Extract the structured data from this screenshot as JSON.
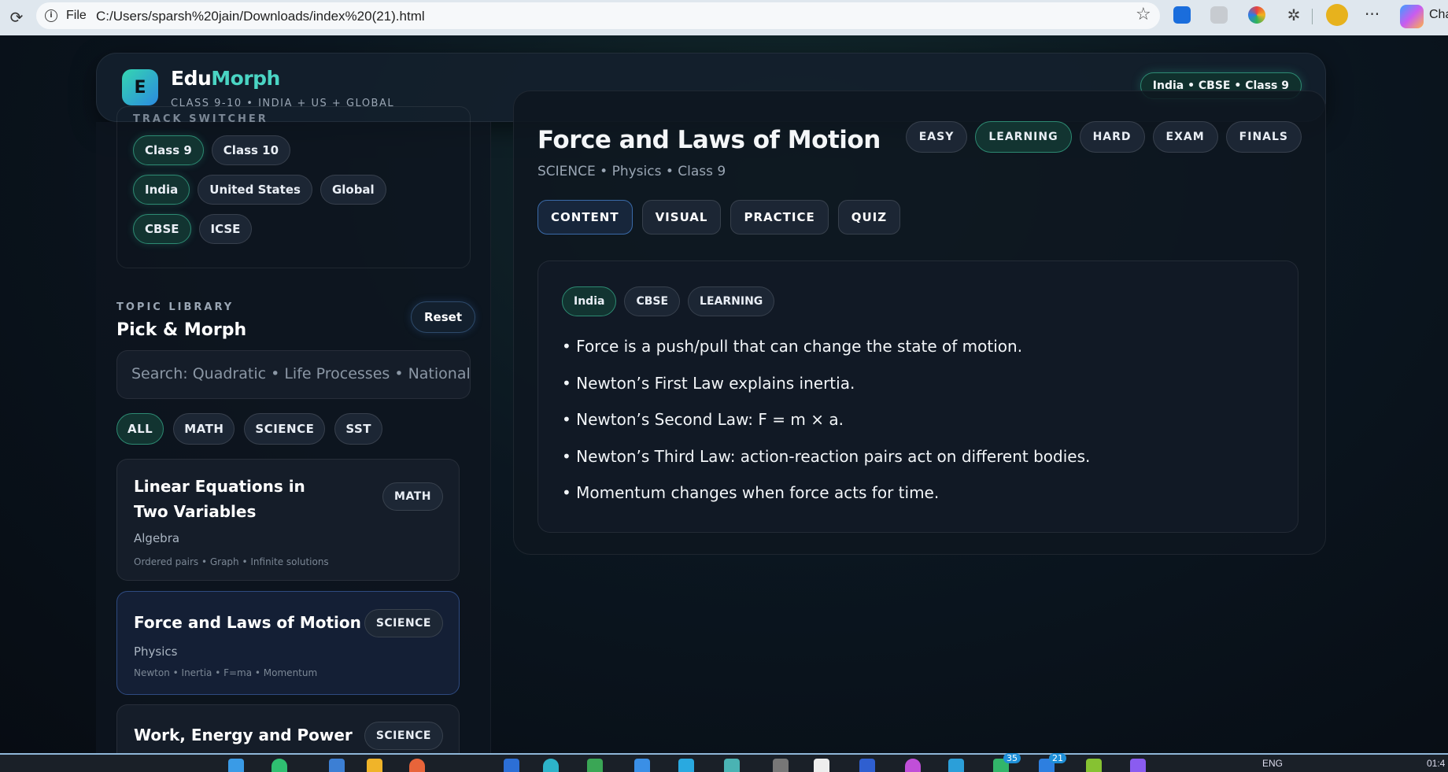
{
  "browser": {
    "file_label": "File",
    "url": "C:/Users/sparsh%20jain/Downloads/index%20(21).html",
    "profile_text": "Cha"
  },
  "header": {
    "logo_letter": "E",
    "brand_part1": "Edu",
    "brand_part2": "Morph",
    "tagline": "CLASS 9-10 • INDIA + US + GLOBAL",
    "track_badge": "India • CBSE • Class 9"
  },
  "sidebar": {
    "switcher_title": "TRACK SWITCHER",
    "classes": [
      {
        "label": "Class 9",
        "active": true
      },
      {
        "label": "Class 10",
        "active": false
      }
    ],
    "regions": [
      {
        "label": "India",
        "active": true
      },
      {
        "label": "United States",
        "active": false
      },
      {
        "label": "Global",
        "active": false
      }
    ],
    "boards": [
      {
        "label": "CBSE",
        "active": true
      },
      {
        "label": "ICSE",
        "active": false
      }
    ],
    "library_label": "TOPIC LIBRARY",
    "library_title": "Pick & Morph",
    "reset_label": "Reset",
    "search_placeholder": "Search: Quadratic • Life Processes • National",
    "filters": [
      {
        "label": "ALL",
        "active": true
      },
      {
        "label": "MATH",
        "active": false
      },
      {
        "label": "SCIENCE",
        "active": false
      },
      {
        "label": "SST",
        "active": false
      }
    ],
    "cards": [
      {
        "title": "Linear Equations in Two Variables",
        "subject": "MATH",
        "sub": "Algebra",
        "tags": "Ordered pairs • Graph • Infinite solutions"
      },
      {
        "title": "Force and Laws of Motion",
        "subject": "SCIENCE",
        "sub": "Physics",
        "tags": "Newton • Inertia • F=ma • Momentum"
      },
      {
        "title": "Work, Energy and Power",
        "subject": "SCIENCE",
        "sub": "",
        "tags": ""
      }
    ]
  },
  "main": {
    "title": "Force and Laws of Motion",
    "meta": "SCIENCE • Physics • Class 9",
    "levels": [
      {
        "label": "EASY",
        "active": false
      },
      {
        "label": "LEARNING",
        "active": true
      },
      {
        "label": "HARD",
        "active": false
      },
      {
        "label": "EXAM",
        "active": false
      },
      {
        "label": "FINALS",
        "active": false
      }
    ],
    "tabs": [
      {
        "label": "CONTENT",
        "active": true
      },
      {
        "label": "VISUAL",
        "active": false
      },
      {
        "label": "PRACTICE",
        "active": false
      },
      {
        "label": "QUIZ",
        "active": false
      }
    ],
    "pills": [
      {
        "label": "India",
        "active": true
      },
      {
        "label": "CBSE",
        "active": false
      },
      {
        "label": "LEARNING",
        "active": false
      }
    ],
    "bullets": [
      "Force is a push/pull that can change the state of motion.",
      "Newton’s First Law explains inertia.",
      "Newton’s Second Law: F = m × a.",
      "Newton’s Third Law: action-reaction pairs act on different bodies.",
      "Momentum changes when force acts for time."
    ]
  },
  "taskbar": {
    "badge1": "35",
    "badge2": "21",
    "lang": "ENG",
    "time": "01:4"
  }
}
